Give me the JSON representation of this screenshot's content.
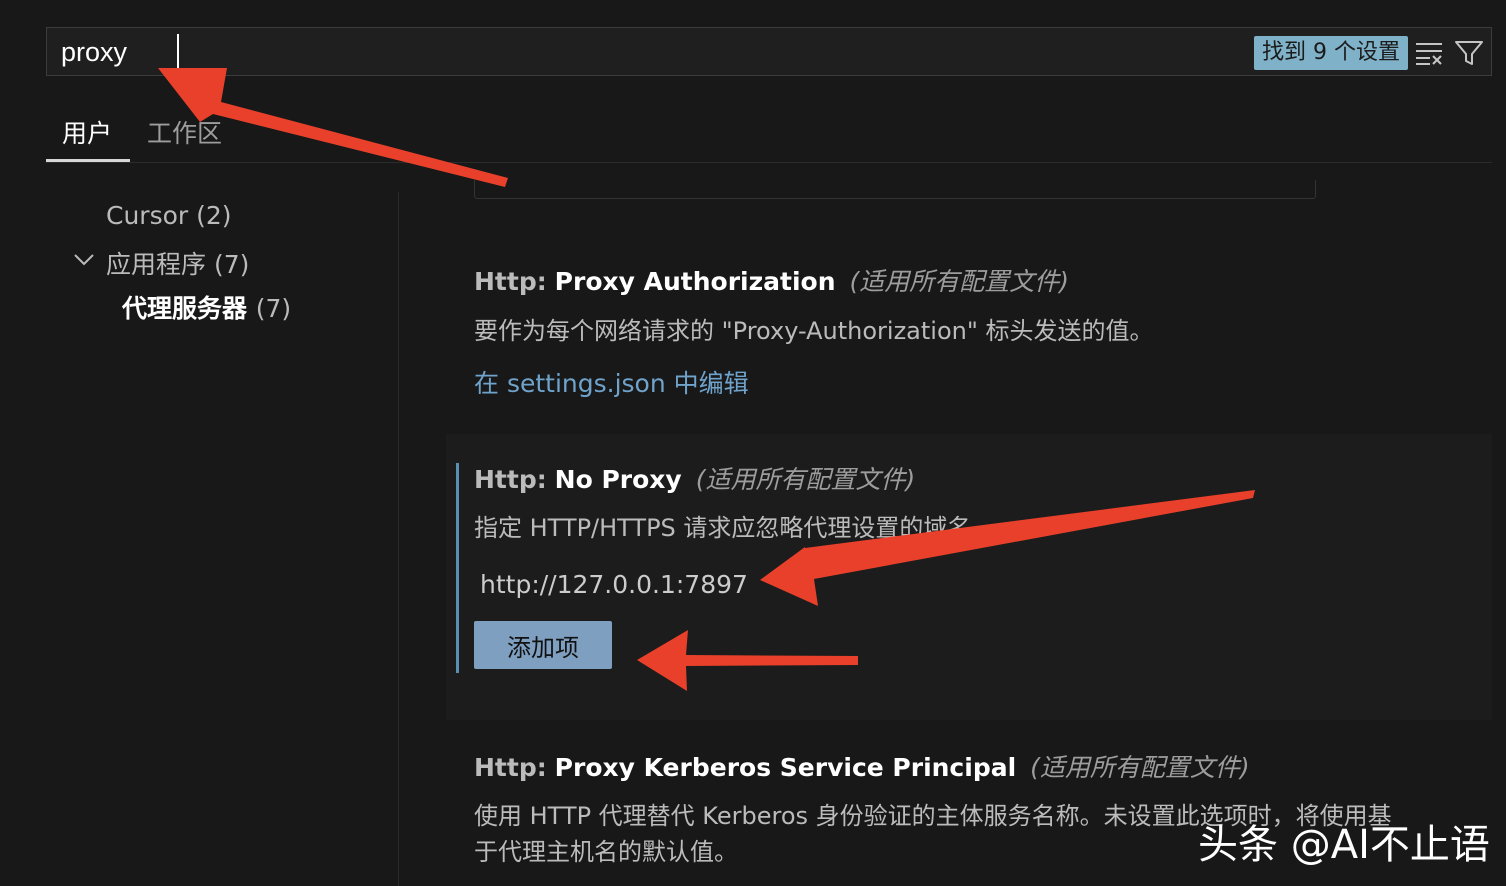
{
  "search": {
    "value": "proxy",
    "result_count": "找到 9 个设置"
  },
  "tabs": [
    {
      "label": "用户"
    },
    {
      "label": "工作区"
    }
  ],
  "toc": [
    {
      "label": "Cursor",
      "count": "(2)"
    },
    {
      "label": "应用程序",
      "count": "(7)"
    },
    {
      "label": "代理服务器",
      "count": "(7)"
    }
  ],
  "settings": [
    {
      "category": "Http:",
      "name": "Proxy Authorization",
      "scope": "(适用所有配置文件)",
      "description": "要作为每个网络请求的 \"Proxy-Authorization\" 标头发送的值。",
      "link": "在 settings.json 中编辑"
    },
    {
      "category": "Http:",
      "name": "No Proxy",
      "scope": "(适用所有配置文件)",
      "description": "指定 HTTP/HTTPS 请求应忽略代理设置的域名",
      "list_items": [
        "http://127.0.0.1:7897"
      ],
      "add_button": "添加项"
    },
    {
      "category": "Http:",
      "name": "Proxy Kerberos Service Principal",
      "scope": "(适用所有配置文件)",
      "description_line1": "使用 HTTP 代理替代 Kerberos 身份验证的主体服务名称。未设置此选项时，将使用基",
      "description_line2": "于代理主机名的默认值。"
    }
  ],
  "watermark": "头条 @AI不止语",
  "colors": {
    "accent": "#7fb2c8",
    "button": "#7f9fc0",
    "annotation_arrow": "#e8402a",
    "focus_bar": "#5a8fb3"
  }
}
